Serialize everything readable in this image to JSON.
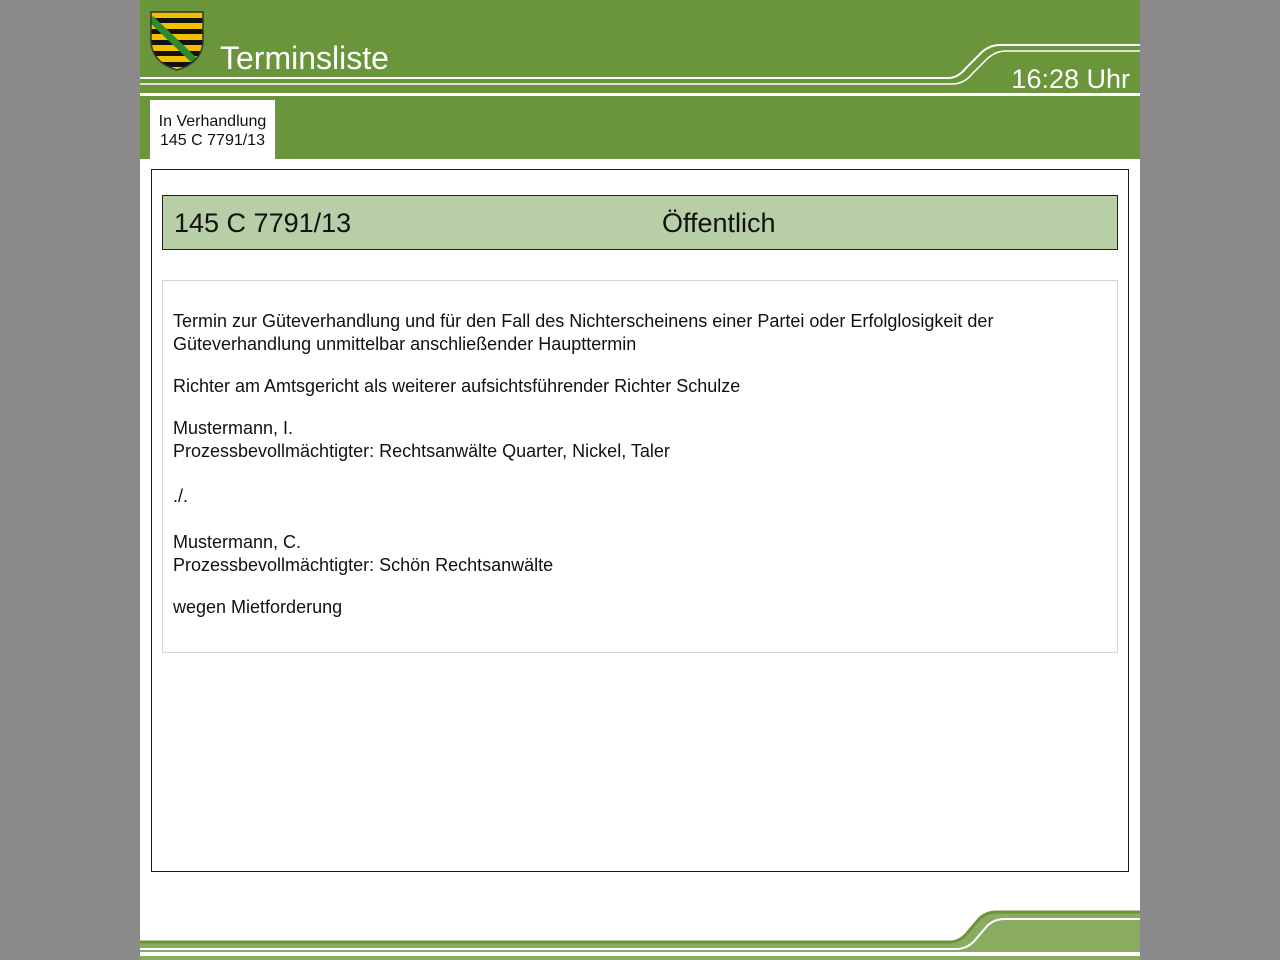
{
  "header": {
    "title": "Terminsliste",
    "clock": "16:28 Uhr"
  },
  "tabs": [
    {
      "line1": "In Verhandlung",
      "line2": "145 C 7791/13"
    }
  ],
  "case": {
    "number": "145 C 7791/13",
    "status": "Öffentlich"
  },
  "details": {
    "hearing_type": "Termin zur Güteverhandlung und für den Fall des Nichterscheinens einer Partei oder Erfolglosigkeit der Güteverhandlung unmittelbar anschließender Haupttermin",
    "judge": "Richter am Amtsgericht als weiterer aufsichtsführender Richter Schulze",
    "plaintiff": {
      "name": "Mustermann, I.",
      "representative": "Prozessbevollmächtigter: Rechtsanwälte Quarter, Nickel, Taler"
    },
    "separator": "./.",
    "defendant": {
      "name": "Mustermann, C.",
      "representative": "Prozessbevollmächtigter: Schön Rechtsanwälte"
    },
    "subject": "wegen Mietforderung"
  },
  "theme": {
    "header_green": "#6a953a",
    "case_bar_green": "#b7cea6",
    "footer_green": "#8aab60"
  }
}
